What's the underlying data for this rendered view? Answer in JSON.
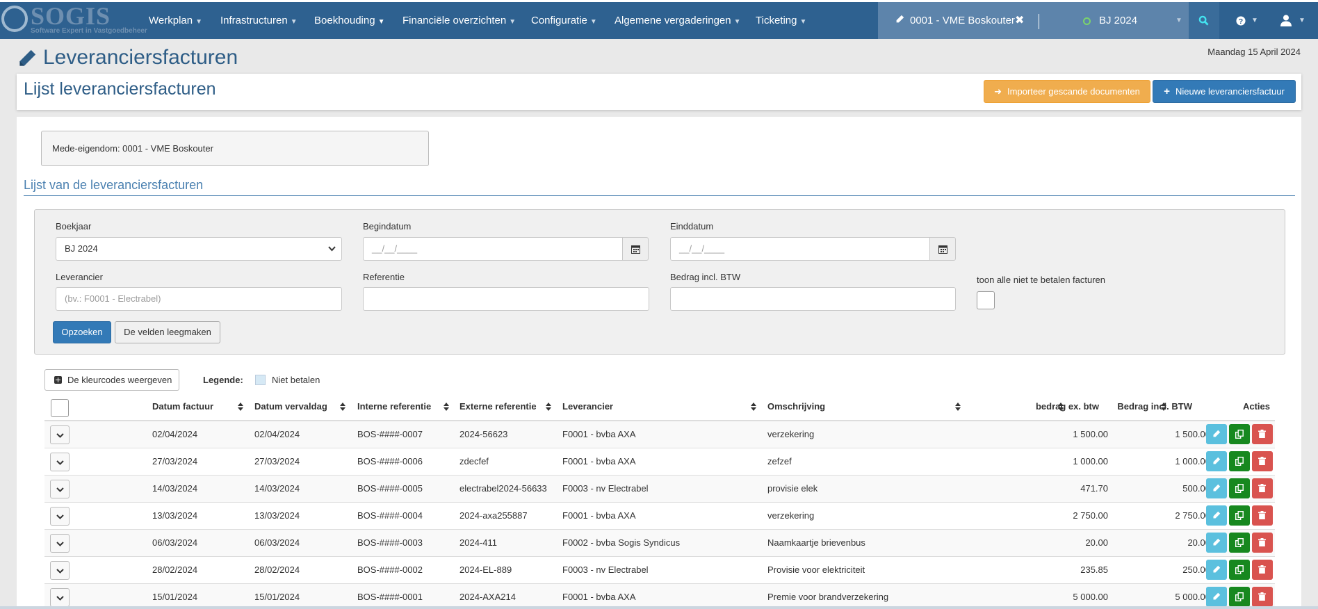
{
  "app": {
    "logo_text": "SOGIS",
    "logo_subtitle": "Software Expert in Vastgoedbeheer"
  },
  "nav": {
    "items": [
      {
        "label": "Werkplan"
      },
      {
        "label": "Infrastructuren"
      },
      {
        "label": "Boekhouding"
      },
      {
        "label": "Financiële overzichten"
      },
      {
        "label": "Configuratie"
      },
      {
        "label": "Algemene vergaderingen"
      },
      {
        "label": "Ticketing"
      }
    ],
    "property": "0001 - VME Boskouter",
    "close_symbol": "✖",
    "year": "BJ 2024"
  },
  "page": {
    "title": "Leveranciersfacturen",
    "date": "Maandag 15 April 2024",
    "card_title": "Lijst leveranciersfacturen",
    "import_button": "Importeer gescande documenten",
    "new_button": "Nieuwe leveranciersfactuur",
    "property_info": "Mede-eigendom: 0001 - VME Boskouter",
    "section_title": "Lijst van de leveranciersfacturen"
  },
  "filters": {
    "boekjaar_label": "Boekjaar",
    "boekjaar_value": "BJ 2024",
    "begindatum_label": "Begindatum",
    "begindatum_value": "__/__/____",
    "einddatum_label": "Einddatum",
    "einddatum_value": "__/__/____",
    "leverancier_label": "Leverancier",
    "leverancier_placeholder": "(bv.: F0001 - Electrabel)",
    "referentie_label": "Referentie",
    "bedrag_label": "Bedrag incl. BTW",
    "toon_label": "toon alle niet te betalen facturen",
    "search_button": "Opzoeken",
    "clear_button": "De velden leegmaken"
  },
  "legend": {
    "colors_button": "De kleurcodes weergeven",
    "title": "Legende:",
    "not_pay": "Niet betalen"
  },
  "table": {
    "columns": {
      "datum_factuur": "Datum factuur",
      "datum_vervaldag": "Datum vervaldag",
      "interne_ref": "Interne referentie",
      "externe_ref": "Externe referentie",
      "leverancier": "Leverancier",
      "omschrijving": "Omschrijving",
      "bedrag_ex": "bedrag ex. btw",
      "bedrag_incl": "Bedrag incl. BTW",
      "acties": "Acties"
    },
    "rows": [
      {
        "datum": "02/04/2024",
        "verval": "02/04/2024",
        "intern": "BOS-####-0007",
        "extern": "2024-56623",
        "leverancier": "F0001 - bvba AXA",
        "omschrijving": "verzekering",
        "ex": "1 500.00",
        "incl": "1 500.00"
      },
      {
        "datum": "27/03/2024",
        "verval": "27/03/2024",
        "intern": "BOS-####-0006",
        "extern": "zdecfef",
        "leverancier": "F0001 - bvba AXA",
        "omschrijving": "zefzef",
        "ex": "1 000.00",
        "incl": "1 000.00"
      },
      {
        "datum": "14/03/2024",
        "verval": "14/03/2024",
        "intern": "BOS-####-0005",
        "extern": "electrabel2024-56633",
        "leverancier": "F0003 - nv Electrabel",
        "omschrijving": "provisie elek",
        "ex": "471.70",
        "incl": "500.00"
      },
      {
        "datum": "13/03/2024",
        "verval": "13/03/2024",
        "intern": "BOS-####-0004",
        "extern": "2024-axa255887",
        "leverancier": "F0001 - bvba AXA",
        "omschrijving": "verzekering",
        "ex": "2 750.00",
        "incl": "2 750.00"
      },
      {
        "datum": "06/03/2024",
        "verval": "06/03/2024",
        "intern": "BOS-####-0003",
        "extern": "2024-411",
        "leverancier": "F0002 - bvba Sogis Syndicus",
        "omschrijving": "Naamkaartje brievenbus",
        "ex": "20.00",
        "incl": "20.00"
      },
      {
        "datum": "28/02/2024",
        "verval": "28/02/2024",
        "intern": "BOS-####-0002",
        "extern": "2024-EL-889",
        "leverancier": "F0003 - nv Electrabel",
        "omschrijving": "Provisie voor elektriciteit",
        "ex": "235.85",
        "incl": "250.00"
      },
      {
        "datum": "15/01/2024",
        "verval": "15/01/2024",
        "intern": "BOS-####-0001",
        "extern": "2024-AXA214",
        "leverancier": "F0001 - bvba AXA",
        "omschrijving": "Premie voor brandverzekering",
        "ex": "5 000.00",
        "incl": "5 000.00"
      }
    ]
  }
}
